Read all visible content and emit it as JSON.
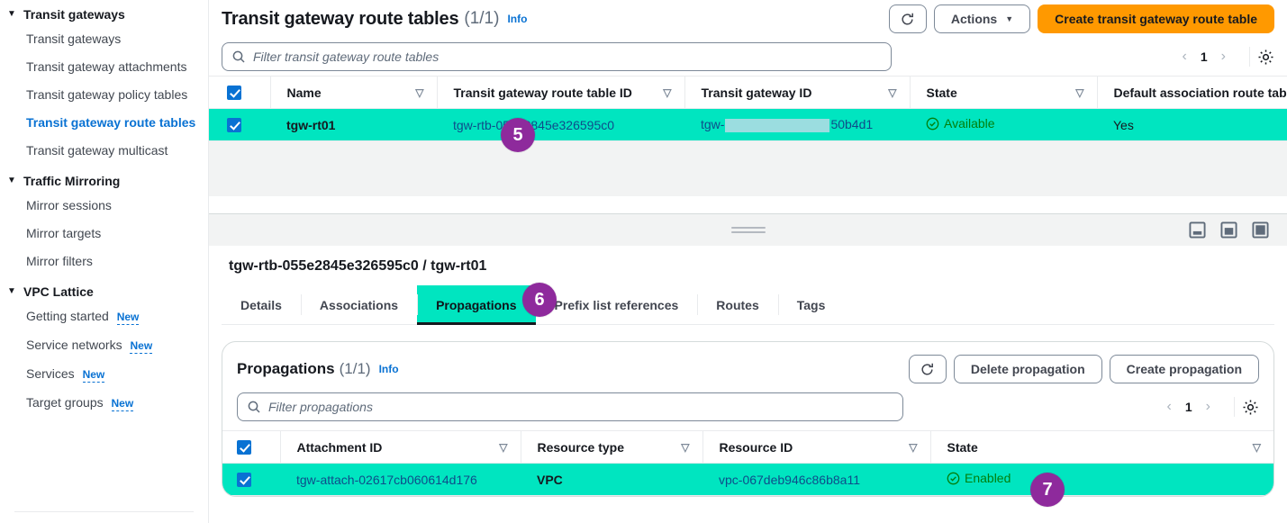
{
  "sidebar": {
    "groups": [
      {
        "label": "Transit gateways",
        "caret": "caret-down-icon",
        "items": [
          {
            "label": "Transit gateways",
            "active": false
          },
          {
            "label": "Transit gateway attachments",
            "active": false
          },
          {
            "label": "Transit gateway policy tables",
            "active": false
          },
          {
            "label": "Transit gateway route tables",
            "active": true
          },
          {
            "label": "Transit gateway multicast",
            "active": false
          }
        ]
      },
      {
        "label": "Traffic Mirroring",
        "caret": "caret-down-icon",
        "items": [
          {
            "label": "Mirror sessions",
            "active": false
          },
          {
            "label": "Mirror targets",
            "active": false
          },
          {
            "label": "Mirror filters",
            "active": false
          }
        ]
      },
      {
        "label": "VPC Lattice",
        "caret": "caret-down-icon",
        "items": [
          {
            "label": "Getting started",
            "badge": "New",
            "active": false
          },
          {
            "label": "Service networks",
            "badge": "New",
            "active": false
          },
          {
            "label": "Services",
            "badge": "New",
            "active": false
          },
          {
            "label": "Target groups",
            "badge": "New",
            "active": false
          }
        ]
      }
    ]
  },
  "page": {
    "title": "Transit gateway route tables",
    "counter": "(1/1)",
    "info": "Info",
    "refresh_icon": "refresh-icon",
    "actions_label": "Actions",
    "actions_caret": "chevron-down-icon",
    "create_label": "Create transit gateway route table",
    "create_color": "#ff9900"
  },
  "filter": {
    "search_icon": "search-icon",
    "placeholder": "Filter transit gateway route tables",
    "prev_icon": "chevron-left-icon",
    "page_number": "1",
    "next_icon": "chevron-right-icon",
    "settings_icon": "gear-icon"
  },
  "route_table": {
    "columns": [
      {
        "label": "Name",
        "sort": "sort-icon"
      },
      {
        "label": "Transit gateway route table ID",
        "sort": "sort-icon"
      },
      {
        "label": "Transit gateway ID",
        "sort": "sort-icon"
      },
      {
        "label": "State",
        "sort": "sort-icon"
      },
      {
        "label": "Default association route tabl",
        "sort": null
      }
    ],
    "rows": [
      {
        "selected": true,
        "highlighted": true,
        "name": "tgw-rt01",
        "route_table_id": "tgw-rtb-055e2845e326595c0",
        "tgw_id_prefix": "tgw-",
        "tgw_id_redacted": true,
        "tgw_id_suffix": "50b4d1",
        "state": "Available",
        "state_icon": "status-success-icon",
        "default_association": "Yes"
      }
    ]
  },
  "split_panel": {
    "drag_handle": "drag-handle-icon",
    "size_icons": [
      "panel-size-small-icon",
      "panel-size-medium-icon",
      "panel-size-large-icon"
    ]
  },
  "detail": {
    "title": "tgw-rtb-055e2845e326595c0 / tgw-rt01",
    "tabs": [
      {
        "label": "Details",
        "active": false,
        "highlighted": false
      },
      {
        "label": "Associations",
        "active": false,
        "highlighted": false
      },
      {
        "label": "Propagations",
        "active": true,
        "highlighted": true
      },
      {
        "label": "Prefix list references",
        "active": false,
        "highlighted": false
      },
      {
        "label": "Routes",
        "active": false,
        "highlighted": false
      },
      {
        "label": "Tags",
        "active": false,
        "highlighted": false
      }
    ]
  },
  "propagations": {
    "title": "Propagations",
    "counter": "(1/1)",
    "info": "Info",
    "refresh_icon": "refresh-icon",
    "delete_label": "Delete propagation",
    "create_label": "Create propagation",
    "filter": {
      "search_icon": "search-icon",
      "placeholder": "Filter propagations",
      "prev_icon": "chevron-left-icon",
      "page_number": "1",
      "next_icon": "chevron-right-icon",
      "settings_icon": "gear-icon"
    },
    "columns": [
      {
        "label": "Attachment ID",
        "sort": "sort-icon"
      },
      {
        "label": "Resource type",
        "sort": "sort-icon"
      },
      {
        "label": "Resource ID",
        "sort": "sort-icon"
      },
      {
        "label": "State",
        "sort": "sort-icon"
      }
    ],
    "rows": [
      {
        "selected": true,
        "highlighted": true,
        "attachment_id": "tgw-attach-02617cb060614d176",
        "resource_type": "VPC",
        "resource_id": "vpc-067deb946c86b8a11",
        "state": "Enabled",
        "state_icon": "status-success-icon"
      }
    ]
  },
  "annotations": [
    {
      "id": "badge5",
      "number": "5",
      "color": "#8e2a9c"
    },
    {
      "id": "badge6",
      "number": "6",
      "color": "#8e2a9c"
    },
    {
      "id": "badge7",
      "number": "7",
      "color": "#8e2a9c"
    }
  ],
  "theme": {
    "highlight": "#00e5c0",
    "link": "#0972d3",
    "success": "#037f0c"
  }
}
